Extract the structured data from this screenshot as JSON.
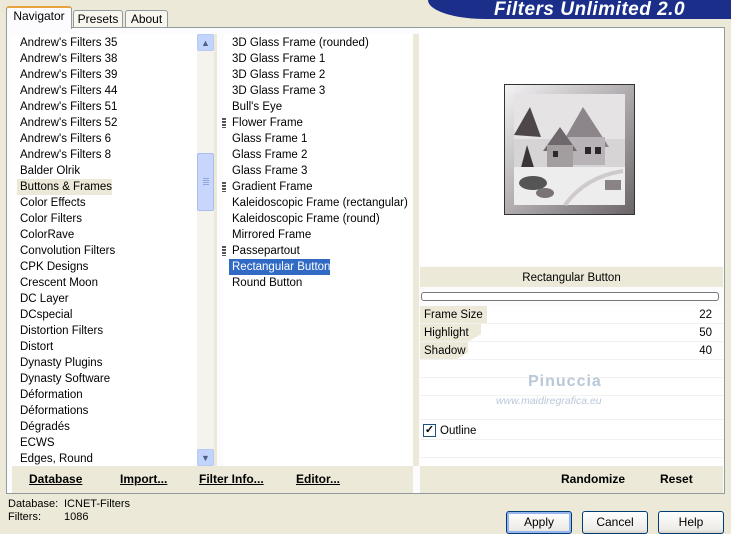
{
  "header": {
    "title": "Filters Unlimited 2.0"
  },
  "tabs": [
    {
      "label": "Navigator",
      "active": true
    },
    {
      "label": "Presets",
      "active": false
    },
    {
      "label": "About",
      "active": false
    }
  ],
  "categories": {
    "items": [
      "Andrew's Filters 35",
      "Andrew's Filters 38",
      "Andrew's Filters 39",
      "Andrew's Filters 44",
      "Andrew's Filters 51",
      "Andrew's Filters 52",
      "Andrew's Filters 6",
      "Andrew's Filters 8",
      "Balder Olrik",
      "Buttons & Frames",
      "Color Effects",
      "Color Filters",
      "ColorRave",
      "Convolution Filters",
      "CPK Designs",
      "Crescent Moon",
      "DC Layer",
      "DCspecial",
      "Distortion Filters",
      "Distort",
      "Dynasty Plugins",
      "Dynasty Software",
      "Déformation",
      "Déformations",
      "Dégradés",
      "ECWS",
      "Edges, Round"
    ],
    "selected": "Buttons & Frames"
  },
  "filters": {
    "items": [
      "3D Glass Frame (rounded)",
      "3D Glass Frame 1",
      "3D Glass Frame 2",
      "3D Glass Frame 3",
      "Bull's Eye",
      "Flower Frame",
      "Glass Frame 1",
      "Glass Frame 2",
      "Glass Frame 3",
      "Gradient Frame",
      "Kaleidoscopic Frame (rectangular)",
      "Kaleidoscopic Frame (round)",
      "Mirrored Frame",
      "Passepartout",
      "Rectangular Button",
      "Round Button"
    ],
    "grouped": [
      "Flower Frame",
      "Gradient Frame",
      "Passepartout"
    ],
    "selected": "Rectangular Button"
  },
  "left_buttons": {
    "database": "Database",
    "import": "Import...",
    "filter_info": "Filter Info...",
    "editor": "Editor..."
  },
  "preview": {
    "filter_name": "Rectangular Button"
  },
  "params": {
    "frame_size": {
      "label": "Frame Size",
      "value": 22
    },
    "highlight": {
      "label": "Highlight",
      "value": 50
    },
    "shadow": {
      "label": "Shadow",
      "value": 40
    },
    "outline": {
      "label": "Outline",
      "checked": true
    }
  },
  "watermark": {
    "name": "Pinuccia",
    "url": "www.maidiregrafica.eu"
  },
  "right_buttons": {
    "randomize": "Randomize",
    "reset": "Reset"
  },
  "status": {
    "database_label": "Database:",
    "database_value": "ICNET-Filters",
    "filters_label": "Filters:",
    "filters_value": "1086"
  },
  "dialog_buttons": {
    "apply": "Apply",
    "cancel": "Cancel",
    "help": "Help"
  },
  "colors": {
    "selection": "#316ac5",
    "banner": "#1b2f8a",
    "face": "#ece9d8"
  }
}
